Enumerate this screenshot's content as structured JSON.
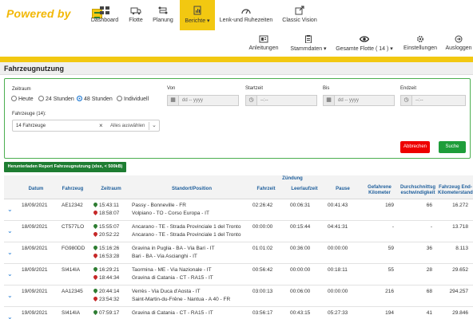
{
  "brand": {
    "text": "Powered by"
  },
  "nav": {
    "items": [
      {
        "label": "Dashboard",
        "icon": "dashboard-icon"
      },
      {
        "label": "Flotte",
        "icon": "truck-icon"
      },
      {
        "label": "Planung",
        "icon": "route-icon"
      },
      {
        "label": "Berichte ▾",
        "icon": "report-icon",
        "active": true
      },
      {
        "label": "Lenk-und Ruhezeiten",
        "icon": "speedometer-icon"
      },
      {
        "label": "Classic Vision",
        "icon": "external-link-icon"
      }
    ],
    "secondary": [
      {
        "label": "Anleitungen",
        "icon": "manual-icon"
      },
      {
        "label": "Stammdaten ▾",
        "icon": "clipboard-icon"
      },
      {
        "label": "Gesamte Flotte ( 14 ) ▾",
        "icon": "eye-icon"
      },
      {
        "label": "Einstellungen",
        "icon": "gear-icon"
      },
      {
        "label": "Ausloggen",
        "icon": "logout-icon"
      }
    ]
  },
  "page": {
    "title": "Fahrzeugnutzung"
  },
  "filter": {
    "zeitraum_label": "Zeitraum",
    "options": [
      "Heute",
      "24 Stunden",
      "48 Stunden",
      "Individuell"
    ],
    "selected_option": "48 Stunden",
    "von_label": "Von",
    "startzeit_label": "Startzeit",
    "bis_label": "Bis",
    "endzeit_label": "Endzeit",
    "date_placeholder": "dd -- yyyy",
    "time_placeholder": "--:--",
    "fahrzeuge_label": "Fahrzeuge (14):",
    "fahrzeuge_value": "14 Fahrzeuge",
    "alles_label": "Alles auswählen",
    "abbrechen": "Abbrechen",
    "suche": "Suche"
  },
  "download_button": "Herunterladen Report Fahrzeugnutzung (xlsx, < 500kB)",
  "table": {
    "group_header": "Zündung",
    "headers": {
      "datum": "Datum",
      "fahrzeug": "Fahrzeug",
      "zeitraum": "Zeitraum",
      "standort": "Standort/Position",
      "fahrzeit": "Fahrzeit",
      "leerlaufzeit": "Leerlaufzeit",
      "pause": "Pause",
      "km": "Gefahrene Kilometer",
      "durchschnitt": "Durchschnittsg eschwindigkeit",
      "kmstand": "Fahrzeug End-Kilometerstand"
    },
    "rows": [
      {
        "datum": "18/09/2021",
        "fahrzeug": "AE12342",
        "start": "15:43:11",
        "end": "18:58:07",
        "von": "Passy - Bonneville - FR",
        "nach": "Volpiano - TO - Corso Europa - IT",
        "fahrzeit": "02:26:42",
        "leerlauf": "00:06:31",
        "pause": "00:41:43",
        "km": "169",
        "avg": "66",
        "kmstand": "16.272"
      },
      {
        "datum": "18/09/2021",
        "fahrzeug": "CT577LO",
        "start": "15:55:07",
        "end": "20:52:22",
        "von": "Ancarano - TE - Strada Provinciale 1 del Tronto",
        "nach": "Ancarano - TE - Strada Provinciale 1 del Tronto",
        "fahrzeit": "00:00:00",
        "leerlauf": "00:15:44",
        "pause": "04:41:31",
        "km": "-",
        "avg": "-",
        "kmstand": "13.718"
      },
      {
        "datum": "18/09/2021",
        "fahrzeug": "FG980DD",
        "start": "15:16:26",
        "end": "16:53:28",
        "von": "Gravina in Puglia - BA - Via Bari - IT",
        "nach": "Bari - BA - Via Ascianghi - IT",
        "fahrzeit": "01:01:02",
        "leerlauf": "00:36:00",
        "pause": "00:00:00",
        "km": "59",
        "avg": "36",
        "kmstand": "8.113"
      },
      {
        "datum": "18/09/2021",
        "fahrzeug": "SI414IA",
        "start": "16:29:21",
        "end": "18:44:34",
        "von": "Taormina - ME - Via Nazionale - IT",
        "nach": "Gravina di Catania - CT - RA15 - IT",
        "fahrzeit": "00:56:42",
        "leerlauf": "00:00:00",
        "pause": "00:18:11",
        "km": "55",
        "avg": "28",
        "kmstand": "29.652"
      },
      {
        "datum": "19/09/2021",
        "fahrzeug": "AA12345",
        "start": "20:44:14",
        "end": "23:54:32",
        "von": "Verrès - Via Duca d'Aosta - IT",
        "nach": "Saint-Martin-du-Frêne - Nantua - A 40 - FR",
        "fahrzeit": "03:00:13",
        "leerlauf": "00:06:00",
        "pause": "00:00:00",
        "km": "216",
        "avg": "68",
        "kmstand": "294.257"
      },
      {
        "datum": "19/09/2021",
        "fahrzeug": "SI414IA",
        "start": "07:59:17",
        "end": "",
        "von": "Gravina di Catania - CT - RA15 - IT",
        "nach": "",
        "fahrzeit": "03:56:17",
        "leerlauf": "00:43:15",
        "pause": "05:27:33",
        "km": "194",
        "avg": "41",
        "kmstand": "29.846"
      }
    ]
  },
  "colors": {
    "accent": "#f2c811",
    "header_text": "#1f5f9c",
    "green": "#1e9d3a",
    "red": "#e00000"
  }
}
